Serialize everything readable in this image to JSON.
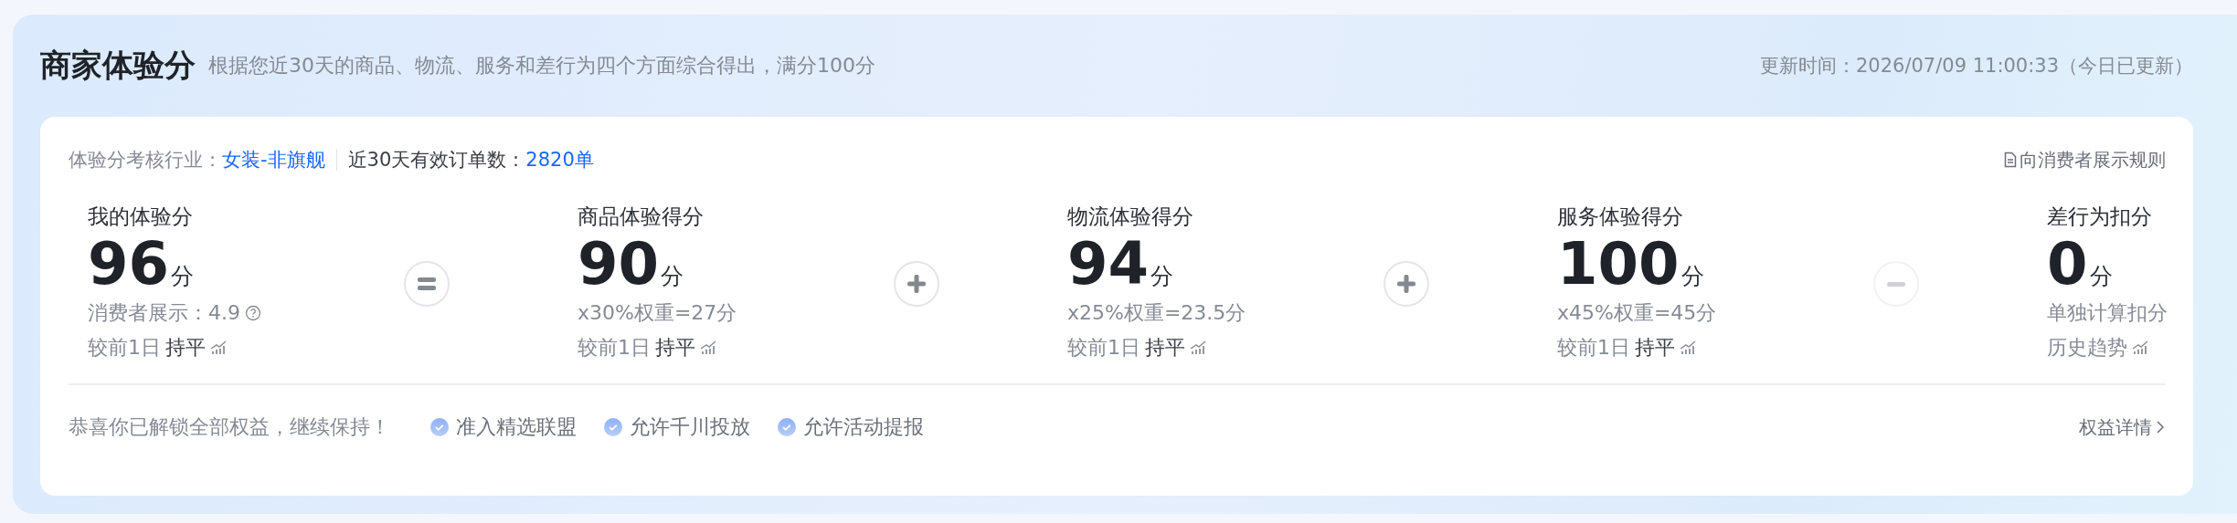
{
  "header": {
    "title": "商家体验分",
    "subtitle": "根据您近30天的商品、物流、服务和差行为四个方面综合得出，满分100分",
    "updated": "更新时间：2026/07/09 11:00:33（今日已更新）"
  },
  "info": {
    "industry_label": "体验分考核行业：",
    "industry": "女装-非旗舰",
    "orders_label": "近30天有效订单数：",
    "orders": "2820单",
    "rules_link": "向消费者展示规则"
  },
  "scores": [
    {
      "label": "我的体验分",
      "value": "96",
      "unit": "分",
      "detail": "消费者展示：4.9",
      "help": true,
      "trend_prefix": "较前1日",
      "trend_value": "持平",
      "kind": "equals"
    },
    {
      "label": "商品体验得分",
      "value": "90",
      "unit": "分",
      "detail": "x30%权重=27分",
      "help": false,
      "trend_prefix": "较前1日",
      "trend_value": "持平",
      "kind": "plus"
    },
    {
      "label": "物流体验得分",
      "value": "94",
      "unit": "分",
      "detail": "x25%权重=23.5分",
      "help": false,
      "trend_prefix": "较前1日",
      "trend_value": "持平",
      "kind": "plus"
    },
    {
      "label": "服务体验得分",
      "value": "100",
      "unit": "分",
      "detail": "x45%权重=45分",
      "help": false,
      "trend_prefix": "较前1日",
      "trend_value": "持平",
      "kind": "minus"
    },
    {
      "label": "差行为扣分",
      "value": "0",
      "unit": "分",
      "detail": "单独计算扣分",
      "help": false,
      "trend_prefix": "历史趋势",
      "kind": "last"
    }
  ],
  "footer": {
    "message": "恭喜你已解锁全部权益，继续保持！",
    "benefits": [
      "准入精选联盟",
      "允许千川投放",
      "允许活动提报"
    ],
    "details_link": "权益详情"
  }
}
